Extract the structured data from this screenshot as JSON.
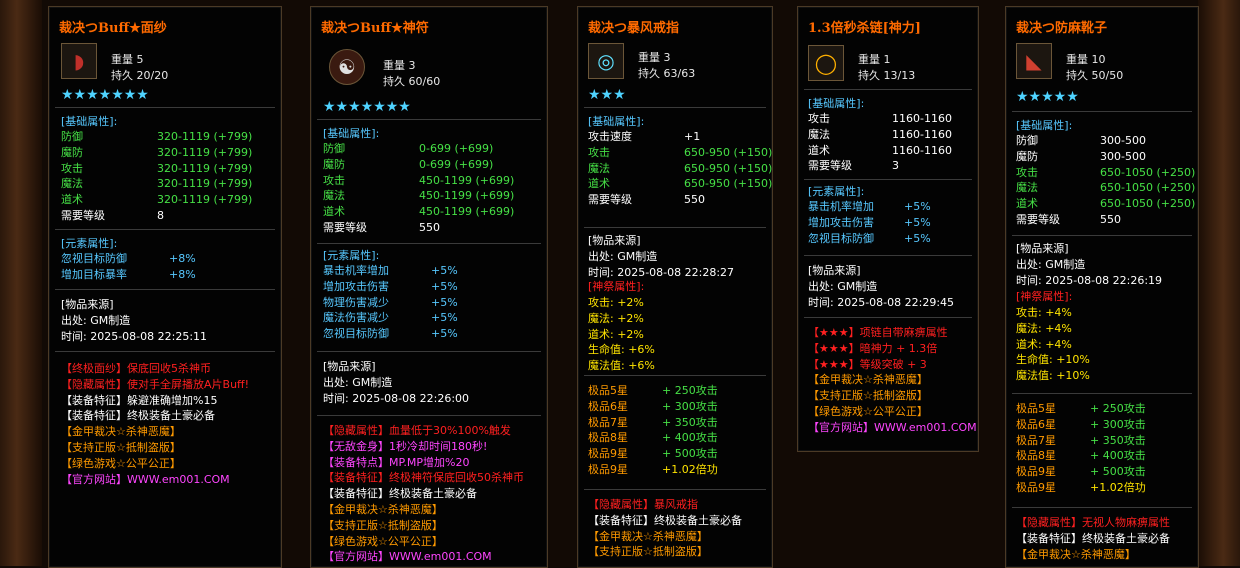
{
  "panels": [
    {
      "title": "裁决つBuff★面纱",
      "icon": "veil-icon",
      "weight": "重量 5",
      "durability": "持久 20/20",
      "stars": "★★★★★★★",
      "base_label": "[基础属性]:",
      "base": [
        {
          "k": "防御",
          "v": "320-1119 (+799)"
        },
        {
          "k": "魔防",
          "v": "320-1119 (+799)"
        },
        {
          "k": "攻击",
          "v": "320-1119 (+799)"
        },
        {
          "k": "魔法",
          "v": "320-1119 (+799)"
        },
        {
          "k": "道术",
          "v": "320-1119 (+799)"
        },
        {
          "k": "需要等级",
          "v": "8"
        }
      ],
      "elem_label": "[元素属性]:",
      "elem": [
        {
          "k": "忽视目标防御",
          "v": "+8%"
        },
        {
          "k": "增加目标暴率",
          "v": "+8%"
        }
      ],
      "source_label": "[物品来源]",
      "source_from": "出处: GM制造",
      "source_time": "时间: 2025-08-08 22:25:11",
      "specials": [
        {
          "t": "【终极面纱】保底回收5杀神币",
          "c": "red"
        },
        {
          "t": "【隐藏属性】使对手全屏播放A片Buff!",
          "c": "red"
        },
        {
          "t": "【装备特征】躲避准确增加%15",
          "c": "white"
        },
        {
          "t": "【装备特征】终极装备土豪必备",
          "c": "white"
        },
        {
          "t": "【金甲裁决☆杀神恶魔】",
          "c": "orange"
        },
        {
          "t": "【支持正版☆抵制盗版】",
          "c": "orange"
        },
        {
          "t": "【绿色游戏☆公平公正】",
          "c": "orange"
        },
        {
          "t": "【官方网站】WWW.em001.COM",
          "c": "pink"
        }
      ]
    },
    {
      "title": "裁决つBuff★神符",
      "icon": "taiji-icon",
      "weight": "重量 3",
      "durability": "持久 60/60",
      "stars": "★★★★★★★",
      "base_label": "[基础属性]:",
      "base": [
        {
          "k": "防御",
          "v": "0-699 (+699)"
        },
        {
          "k": "魔防",
          "v": "0-699 (+699)"
        },
        {
          "k": "攻击",
          "v": "450-1199 (+699)"
        },
        {
          "k": "魔法",
          "v": "450-1199 (+699)"
        },
        {
          "k": "道术",
          "v": "450-1199 (+699)"
        },
        {
          "k": "需要等级",
          "v": "550"
        }
      ],
      "elem_label": "[元素属性]:",
      "elem": [
        {
          "k": "暴击机率增加",
          "v": "+5%"
        },
        {
          "k": "增加攻击伤害",
          "v": "+5%"
        },
        {
          "k": "物理伤害减少",
          "v": "+5%"
        },
        {
          "k": "魔法伤害减少",
          "v": "+5%"
        },
        {
          "k": "忽视目标防御",
          "v": "+5%"
        }
      ],
      "source_label": "[物品来源]",
      "source_from": "出处: GM制造",
      "source_time": "时间: 2025-08-08 22:26:00",
      "specials": [
        {
          "t": "【隐藏属性】血量低于30%100%触发",
          "c": "red"
        },
        {
          "t": "【无敌金身】1秒冷却时间180秒!",
          "c": "pink"
        },
        {
          "t": "【装备特点】MP.MP增加%20",
          "c": "pink"
        },
        {
          "t": "【装备特征】终极神符保底回收50杀神币",
          "c": "red"
        },
        {
          "t": "【装备特征】终极装备土豪必备",
          "c": "white"
        },
        {
          "t": "【金甲裁决☆杀神恶魔】",
          "c": "orange"
        },
        {
          "t": "【支持正版☆抵制盗版】",
          "c": "orange"
        },
        {
          "t": "【绿色游戏☆公平公正】",
          "c": "orange"
        },
        {
          "t": "【官方网站】WWW.em001.COM",
          "c": "pink"
        }
      ]
    },
    {
      "title": "裁决つ暴风戒指",
      "icon": "ring-icon",
      "weight": "重量 3",
      "durability": "持久 63/63",
      "stars": "★★★",
      "base_label": "[基础属性]:",
      "base": [
        {
          "k": "攻击速度",
          "v": "+1"
        },
        {
          "k": "攻击",
          "v": "650-950 (+150)"
        },
        {
          "k": "魔法",
          "v": "650-950 (+150)"
        },
        {
          "k": "道术",
          "v": "650-950 (+150)"
        },
        {
          "k": "需要等级",
          "v": "550"
        }
      ],
      "source_label": "[物品来源]",
      "source_from": "出处: GM制造",
      "source_time": "时间: 2025-08-08 22:28:27",
      "sacred_label": "[神祭属性]:",
      "sacred": [
        "攻击: +2%",
        "魔法: +2%",
        "道术: +2%",
        "生命值: +6%",
        "魔法值: +6%"
      ],
      "grades": [
        {
          "k": "极品5星",
          "v": "+ 250攻击"
        },
        {
          "k": "极品6星",
          "v": "+ 300攻击"
        },
        {
          "k": "极品7星",
          "v": "+ 350攻击"
        },
        {
          "k": "极品8星",
          "v": "+ 400攻击"
        },
        {
          "k": "极品9星",
          "v": "+ 500攻击"
        },
        {
          "k": "极品9星",
          "v": "+1.02倍功"
        }
      ],
      "specials": [
        {
          "t": "【隐藏属性】暴风戒指",
          "c": "red"
        },
        {
          "t": "【装备特征】终极装备土豪必备",
          "c": "white"
        },
        {
          "t": "【金甲裁决☆杀神恶魔】",
          "c": "orange"
        },
        {
          "t": "【支持正版☆抵制盗版】",
          "c": "orange"
        }
      ]
    },
    {
      "title": "1.3倍秒杀链[神力]",
      "icon": "necklace-icon",
      "weight": "重量 1",
      "durability": "持久 13/13",
      "base_label": "[基础属性]:",
      "base": [
        {
          "k": "攻击",
          "v": "1160-1160"
        },
        {
          "k": "魔法",
          "v": "1160-1160"
        },
        {
          "k": "道术",
          "v": "1160-1160"
        },
        {
          "k": "需要等级",
          "v": "3"
        }
      ],
      "elem_label": "[元素属性]:",
      "elem": [
        {
          "k": "暴击机率增加",
          "v": "+5%"
        },
        {
          "k": "增加攻击伤害",
          "v": "+5%"
        },
        {
          "k": "忽视目标防御",
          "v": "+5%"
        }
      ],
      "source_label": "[物品来源]",
      "source_from": "出处: GM制造",
      "source_time": "时间: 2025-08-08 22:29:45",
      "specials": [
        {
          "t": "【★★★】项链自带麻痹属性",
          "c": "red"
        },
        {
          "t": "【★★★】暗神力 + 1.3倍",
          "c": "red"
        },
        {
          "t": "【★★★】等级突破 + 3",
          "c": "red"
        },
        {
          "t": "【金甲裁决☆杀神恶魔】",
          "c": "orange"
        },
        {
          "t": "【支持正版☆抵制盗版】",
          "c": "orange"
        },
        {
          "t": "【绿色游戏☆公平公正】",
          "c": "orange"
        },
        {
          "t": "【官方网站】WWW.em001.COM",
          "c": "pink"
        }
      ]
    },
    {
      "title": "裁决つ防麻靴子",
      "icon": "boots-icon",
      "weight": "重量 10",
      "durability": "持久 50/50",
      "stars": "★★★★★",
      "base_label": "[基础属性]:",
      "base": [
        {
          "k": "防御",
          "v": "300-500"
        },
        {
          "k": "魔防",
          "v": "300-500"
        },
        {
          "k": "攻击",
          "v": "650-1050 (+250)"
        },
        {
          "k": "魔法",
          "v": "650-1050 (+250)"
        },
        {
          "k": "道术",
          "v": "650-1050 (+250)"
        },
        {
          "k": "需要等级",
          "v": "550"
        }
      ],
      "source_label": "[物品来源]",
      "source_from": "出处: GM制造",
      "source_time": "时间: 2025-08-08 22:26:19",
      "sacred_label": "[神祭属性]:",
      "sacred": [
        "攻击: +4%",
        "魔法: +4%",
        "道术: +4%",
        "生命值: +10%",
        "魔法值: +10%"
      ],
      "grades": [
        {
          "k": "极品5星",
          "v": "+ 250攻击"
        },
        {
          "k": "极品6星",
          "v": "+ 300攻击"
        },
        {
          "k": "极品7星",
          "v": "+ 350攻击"
        },
        {
          "k": "极品8星",
          "v": "+ 400攻击"
        },
        {
          "k": "极品9星",
          "v": "+ 500攻击"
        },
        {
          "k": "极品9星",
          "v": "+1.02倍功"
        }
      ],
      "specials": [
        {
          "t": "【隐藏属性】无视人物麻痹属性",
          "c": "red"
        },
        {
          "t": "【装备特征】终极装备土豪必备",
          "c": "white"
        },
        {
          "t": "【金甲裁决☆杀神恶魔】",
          "c": "orange"
        }
      ]
    }
  ]
}
